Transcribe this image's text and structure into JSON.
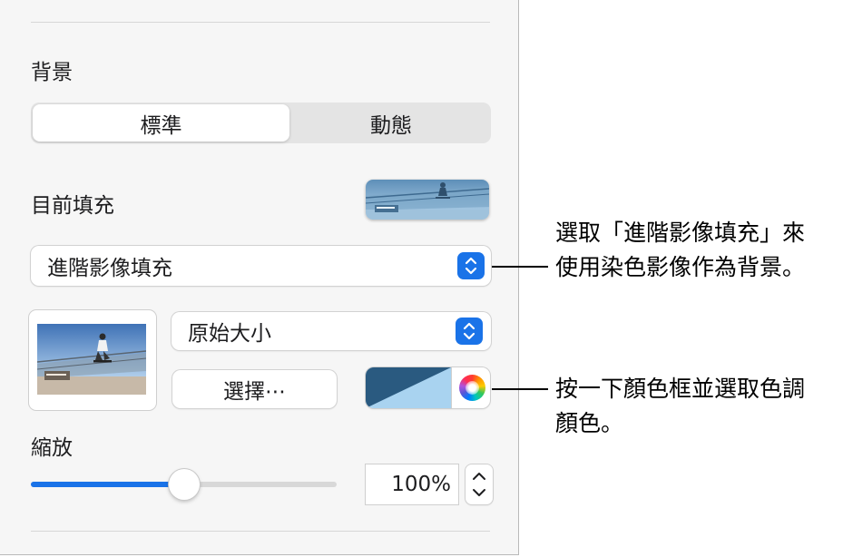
{
  "panel": {
    "background_title": "背景",
    "segments": [
      "標準",
      "動態"
    ],
    "selected_segment": "標準",
    "current_fill_label": "目前填充",
    "fill_type_value": "進階影像填充",
    "scale_mode_value": "原始大小",
    "choose_button": "選擇⋯",
    "scale_label": "縮放",
    "scale_value": "100%",
    "scale_fraction": 0.5,
    "tint_color": "#2a5a80",
    "tint_light": "#a9d3f0",
    "accent": "#1a73e8"
  },
  "callouts": {
    "fill_note_line1": "選取「進階影像填充」來",
    "fill_note_line2": "使用染色影像作為背景。",
    "color_note_line1": "按一下顏色框並選取色調",
    "color_note_line2": "顏色。"
  }
}
